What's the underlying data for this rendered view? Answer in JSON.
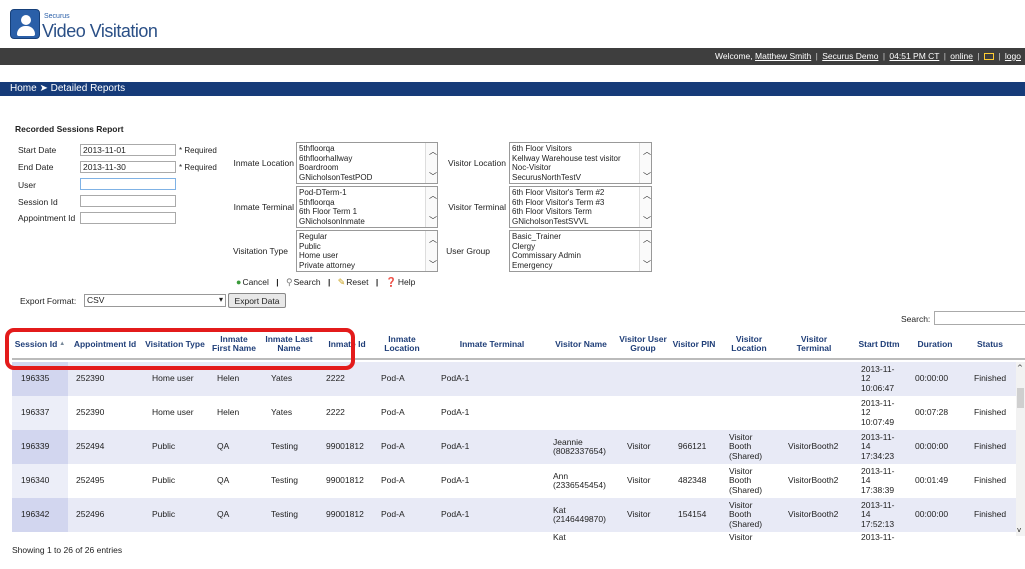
{
  "app": {
    "brand_small": "Securus",
    "brand_name": "Video Visitation"
  },
  "topbar": {
    "welcome": "Welcome,",
    "user": "Matthew Smith",
    "org": "Securus Demo",
    "time": "04:51 PM CT",
    "status": "online",
    "logout": "logo"
  },
  "breadcrumb": "Home ➤ Detailed Reports",
  "report": {
    "title": "Recorded Sessions Report",
    "fields": [
      {
        "label": "Start Date",
        "value": "2013-11-01",
        "req": "* Required"
      },
      {
        "label": "End Date",
        "value": "2013-11-30",
        "req": "* Required"
      },
      {
        "label": "User",
        "value": ""
      },
      {
        "label": "Session Id",
        "value": ""
      },
      {
        "label": "Appointment Id",
        "value": ""
      }
    ],
    "inmate_location": {
      "label": "Inmate Location",
      "options": [
        "5thfloorqa",
        "6thfloorhallway",
        "Boardroom",
        "GNicholsonTestPOD"
      ]
    },
    "inmate_terminal": {
      "label": "Inmate Terminal",
      "options": [
        "Pod-DTerm-1",
        "5thfloorqa",
        "6th Floor Term 1",
        "GNicholsonInmate"
      ]
    },
    "visitation_type": {
      "label": "Visitation Type",
      "options": [
        "Regular",
        "Public",
        "Home user",
        "Private attorney"
      ]
    },
    "visitor_location": {
      "label": "Visitor Location",
      "options": [
        "6th Floor Visitors",
        "Kellway Warehouse test visitor",
        "Noc-Visitor",
        "SecurusNorthTestV"
      ]
    },
    "visitor_terminal": {
      "label": "Visitor Terminal",
      "options": [
        "6th Floor Visitor's Term #2",
        "6th Floor Visitor's Term #3",
        "6th Floor Visitors Term",
        "GNicholsonTestSVVL"
      ]
    },
    "user_group": {
      "label": "User Group",
      "options": [
        "Basic_Trainer",
        "Clergy",
        "Commissary Admin",
        "Emergency"
      ]
    },
    "actions": {
      "cancel": "Cancel",
      "search": "Search",
      "reset": "Reset",
      "help": "Help"
    },
    "export": {
      "label": "Export Format:",
      "value": "CSV",
      "button": "Export Data"
    },
    "search_label": "Search:"
  },
  "table": {
    "headers": [
      "Session Id",
      "Appointment Id",
      "Visitation Type",
      "Inmate First Name",
      "Inmate Last Name",
      "Inmate Id",
      "Inmate Location",
      "Inmate Terminal",
      "Visitor Name",
      "Visitor User Group",
      "Visitor PIN",
      "Visitor Location",
      "Visitor Terminal",
      "Start Dttm",
      "Duration",
      "Status"
    ],
    "rows": [
      [
        "196335",
        "252390",
        "Home user",
        "Helen",
        "Yates",
        "2222",
        "Pod-A",
        "PodA-1",
        "",
        "",
        "",
        "",
        "",
        "2013-11-12 10:06:47",
        "00:00:00",
        "Finished"
      ],
      [
        "196337",
        "252390",
        "Home user",
        "Helen",
        "Yates",
        "2222",
        "Pod-A",
        "PodA-1",
        "",
        "",
        "",
        "",
        "",
        "2013-11-12 10:07:49",
        "00:07:28",
        "Finished"
      ],
      [
        "196339",
        "252494",
        "Public",
        "QA",
        "Testing",
        "99001812",
        "Pod-A",
        "PodA-1",
        "Jeannie (8082337654)",
        "Visitor",
        "966121",
        "Visitor Booth (Shared)",
        "VisitorBooth2",
        "2013-11-14 17:34:23",
        "00:00:00",
        "Finished"
      ],
      [
        "196340",
        "252495",
        "Public",
        "QA",
        "Testing",
        "99001812",
        "Pod-A",
        "PodA-1",
        "Ann (2336545454)",
        "Visitor",
        "482348",
        "Visitor Booth (Shared)",
        "VisitorBooth2",
        "2013-11-14 17:38:39",
        "00:01:49",
        "Finished"
      ],
      [
        "196342",
        "252496",
        "Public",
        "QA",
        "Testing",
        "99001812",
        "Pod-A",
        "PodA-1",
        "Kat (2146449870)",
        "Visitor",
        "154154",
        "Visitor Booth (Shared)",
        "VisitorBooth2",
        "2013-11-14 17:52:13",
        "00:00:00",
        "Finished"
      ],
      [
        "",
        "",
        "",
        "",
        "",
        "",
        "",
        "",
        "Kat",
        "",
        "",
        "Visitor",
        "",
        "2013-11-",
        "",
        ""
      ]
    ],
    "footer": "Showing 1 to 26 of 26 entries"
  },
  "colors": {
    "nav": "#163b79",
    "header_text": "#1f3e78",
    "highlight": "#e31b1b",
    "row_alt": "#e8eaf6"
  }
}
